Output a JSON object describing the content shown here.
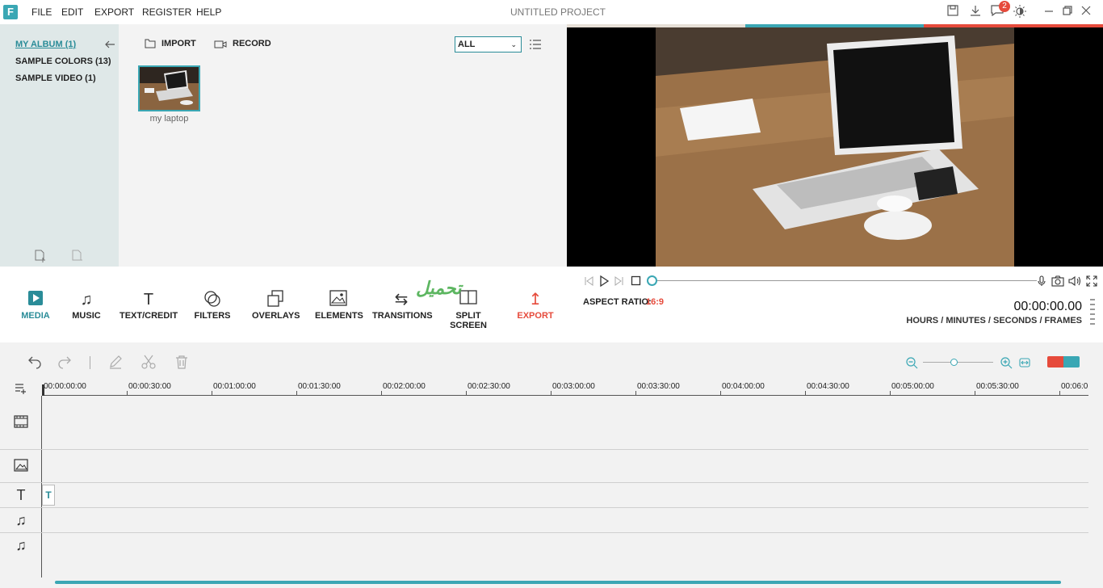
{
  "menu": {
    "file": "FILE",
    "edit": "EDIT",
    "export": "EXPORT",
    "register": "REGISTER",
    "help": "HELP"
  },
  "project_title": "UNTITLED PROJECT",
  "notification_count": "2",
  "app_logo": "F",
  "album": {
    "items": [
      {
        "label": "MY ALBUM (1)"
      },
      {
        "label": "SAMPLE COLORS (13)"
      },
      {
        "label": "SAMPLE VIDEO (1)"
      }
    ]
  },
  "media": {
    "import_label": "IMPORT",
    "record_label": "RECORD",
    "filter_selected": "ALL",
    "thumbnail_label": "my laptop"
  },
  "tools": {
    "media": "MEDIA",
    "music": "MUSIC",
    "text_credit": "TEXT/CREDIT",
    "filters": "FILTERS",
    "overlays": "OVERLAYS",
    "elements": "ELEMENTS",
    "transitions": "TRANSITIONS",
    "split_screen": "SPLIT SCREEN",
    "export": "EXPORT"
  },
  "aspect_ratio": {
    "label": "ASPECT RATIO:",
    "value": "16:9"
  },
  "timecode": {
    "value": "00:00:00.00",
    "units": "HOURS / MINUTES / SECONDS / FRAMES"
  },
  "watermark": "تحميل",
  "timeline": {
    "ticks": [
      "00:00:00:00",
      "00:00:30:00",
      "00:01:00:00",
      "00:01:30:00",
      "00:02:00:00",
      "00:02:30:00",
      "00:03:00:00",
      "00:03:30:00",
      "00:04:00:00",
      "00:04:30:00",
      "00:05:00:00",
      "00:05:30:00",
      "00:06:0"
    ],
    "text_clip": "T"
  },
  "colors": {
    "accent": "#3aa7b4",
    "danger": "#e64a3b"
  }
}
